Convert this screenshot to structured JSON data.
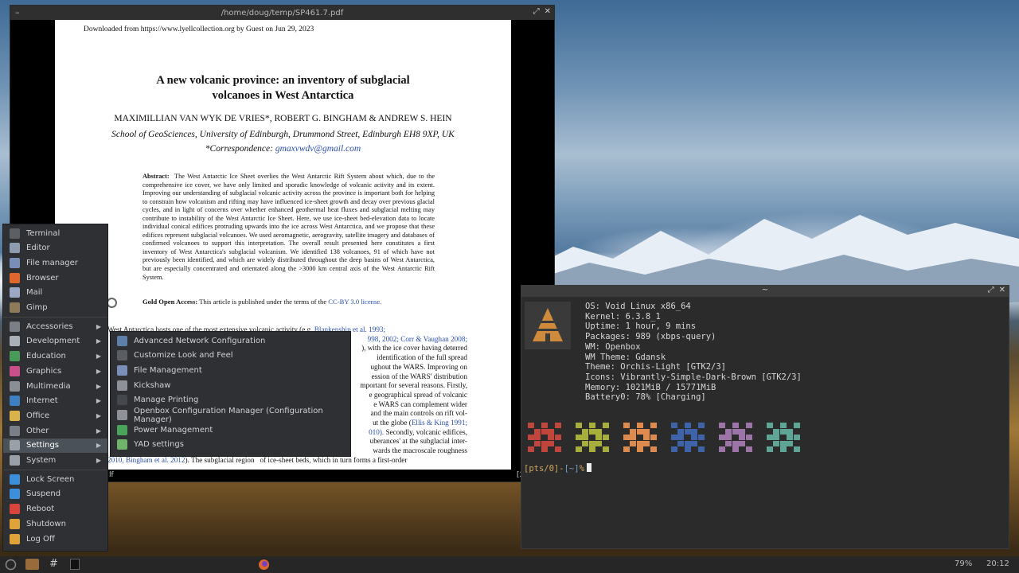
{
  "pdf_viewer": {
    "title": "/home/doug/temp/SP461.7.pdf",
    "page": {
      "download_notice": "Downloaded from https://www.lyellcollection.org by Guest on Jun 29, 2023",
      "title_line1": "A new volcanic province: an inventory of subglacial",
      "title_line2": "volcanoes in West Antarctica",
      "authors": "MAXIMILLIAN VAN WYK DE VRIES*, ROBERT G. BINGHAM & ANDREW S. HEIN",
      "affiliation": "School of GeoSciences, University of Edinburgh, Drummond Street, Edinburgh EH8 9XP, UK",
      "correspondence_label": "*Correspondence:",
      "correspondence_email": "gmaxvwdv@gmail.com",
      "abstract_label": "Abstract:",
      "abstract_text": "The West Antarctic Ice Sheet overlies the West Antarctic Rift System about which, due to the comprehensive ice cover, we have only limited and sporadic knowledge of volcanic activity and its extent. Improving our understanding of subglacial volcanic activity across the province is important both for helping to constrain how volcanism and rifting may have influenced ice-sheet growth and decay over previous glacial cycles, and in light of concerns over whether enhanced geothermal heat fluxes and subglacial melting may contribute to instability of the West Antarctic Ice Sheet. Here, we use ice-sheet bed-elevation data to locate individual conical edifices protruding upwards into the ice across West Antarctica, and we propose that these edifices represent subglacial volcanoes. We used aeromagnetic, aerogravity, satellite imagery and databases of confirmed volcanoes to support this interpretation. The overall result presented here constitutes a first inventory of West Antarctica's subglacial volcanism. We identified 138 volcanoes, 91 of which have not previously been identified, and which are widely distributed throughout the deep basins of West Antarctica, but are especially concentrated and orientated along the >3000 km central axis of the West Antarctic Rift System.",
      "open_access_label": "Gold Open Access:",
      "open_access_text": "This article is published under the terms of the",
      "license_link": "CC-BY 3.0 license.",
      "body_line1_a": "West Antarctica hosts one of the most extensive",
      "body_line1_b": "volcanic activity (e.g.",
      "body_line1_ref": "Blankenship et al. 1993;",
      "body_line2_ref": "998, 2002; Corr & Vaughan 2008;",
      "body_line3": "), with the ice cover having deterred",
      "body_line4": "identification of the full spread",
      "body_line5": "ughout the WARS. Improving on",
      "body_line6": "ession of the WARS' distribution",
      "body_line7": "mportant for several reasons. Firstly,",
      "body_line8": "e geographical spread of volcanic",
      "body_line9": "e WARS can complement wider",
      "body_line10": "and the main controls on rift vol-",
      "body_line11_a": "ut the globe (",
      "body_line11_ref": "Ellis & King 1991;",
      "body_line12_ref": "010).",
      "body_line12_b": "Secondly, volcanic edifices,",
      "body_line13": "uberances' at the subglacial inter-",
      "body_line14": "wards the macroscale roughness",
      "body_line15_ref": "2010, Bingham et al. 2012",
      "body_line15_b": "). The subglacial region",
      "body_line15_c": "of ice-sheet beds, which in turn forms a first-order"
    },
    "status_left": "lf",
    "status_right": "[23"
  },
  "terminal": {
    "title": "~",
    "neofetch": [
      "OS: Void Linux x86_64",
      "Kernel: 6.3.8_1",
      "Uptime: 1 hour, 9 mins",
      "Packages: 989 (xbps-query)",
      "WM: Openbox",
      "WM Theme: Gdansk",
      "Theme: Orchis-Light [GTK2/3]",
      "Icons: Vibrantly-Simple-Dark-Brown [GTK2/3]",
      "Memory: 1021MiB / 15771MiB",
      "Battery0: 78% [Charging]"
    ],
    "swatch_colors": [
      "#c0453d",
      "#a7ae3c",
      "#dc8a4e",
      "#3f63a8",
      "#9d74a8",
      "#5ea596"
    ],
    "prompt_pts": "[pts/0]",
    "prompt_path": "[~]",
    "prompt_symbol": "%"
  },
  "app_menu": {
    "items": [
      {
        "label": "Terminal",
        "icon": "terminal-icon",
        "color": "#5c5f63"
      },
      {
        "label": "Editor",
        "icon": "editor-icon",
        "color": "#8c9bb0"
      },
      {
        "label": "File manager",
        "icon": "folder-icon",
        "color": "#7a8fb8"
      },
      {
        "label": "Browser",
        "icon": "firefox-icon",
        "color": "#e0672c"
      },
      {
        "label": "Mail",
        "icon": "mail-icon",
        "color": "#9aa8c6"
      },
      {
        "label": "Gimp",
        "icon": "gimp-icon",
        "color": "#8d7a5a"
      }
    ],
    "categories": [
      {
        "label": "Accessories",
        "icon": "accessories-icon",
        "color": "#7b7f86"
      },
      {
        "label": "Development",
        "icon": "development-icon",
        "color": "#aab0b8"
      },
      {
        "label": "Education",
        "icon": "education-icon",
        "color": "#4a9a5a"
      },
      {
        "label": "Graphics",
        "icon": "graphics-icon",
        "color": "#c9508a"
      },
      {
        "label": "Multimedia",
        "icon": "multimedia-icon",
        "color": "#8a8f96"
      },
      {
        "label": "Internet",
        "icon": "internet-icon",
        "color": "#3d7fc0"
      },
      {
        "label": "Office",
        "icon": "office-icon",
        "color": "#d9b24a"
      },
      {
        "label": "Other",
        "icon": "other-icon",
        "color": "#7a7f87"
      },
      {
        "label": "Settings",
        "icon": "settings-icon",
        "color": "#9aa0a8"
      },
      {
        "label": "System",
        "icon": "system-icon",
        "color": "#9aa0a8"
      }
    ],
    "session": [
      {
        "label": "Lock Screen",
        "icon": "lock-icon",
        "color": "#3d8fd9"
      },
      {
        "label": "Suspend",
        "icon": "suspend-icon",
        "color": "#3d8fd9"
      },
      {
        "label": "Reboot",
        "icon": "reboot-icon",
        "color": "#d9443d"
      },
      {
        "label": "Shutdown",
        "icon": "shutdown-icon",
        "color": "#e0a33a"
      },
      {
        "label": "Log Off",
        "icon": "logoff-icon",
        "color": "#e0a33a"
      }
    ]
  },
  "settings_submenu": {
    "items": [
      {
        "label": "Advanced Network Configuration",
        "icon": "network-icon",
        "color": "#5e7fa8"
      },
      {
        "label": "Customize Look and Feel",
        "icon": "appearance-icon",
        "color": "#5a5d62"
      },
      {
        "label": "File Management",
        "icon": "file-management-icon",
        "color": "#7a8fb8"
      },
      {
        "label": "Kickshaw",
        "icon": "kickshaw-icon",
        "color": "#8e9298"
      },
      {
        "label": "Manage Printing",
        "icon": "printer-icon",
        "color": "#44474c"
      },
      {
        "label": "Openbox Configuration Manager (Configuration Manager)",
        "icon": "openbox-icon",
        "color": "#8e9298"
      },
      {
        "label": "Power Management",
        "icon": "power-management-icon",
        "color": "#4aa35a"
      },
      {
        "label": "YAD settings",
        "icon": "yad-icon",
        "color": "#6fb46a"
      }
    ]
  },
  "taskbar": {
    "battery": "79%",
    "clock": "20:12"
  }
}
